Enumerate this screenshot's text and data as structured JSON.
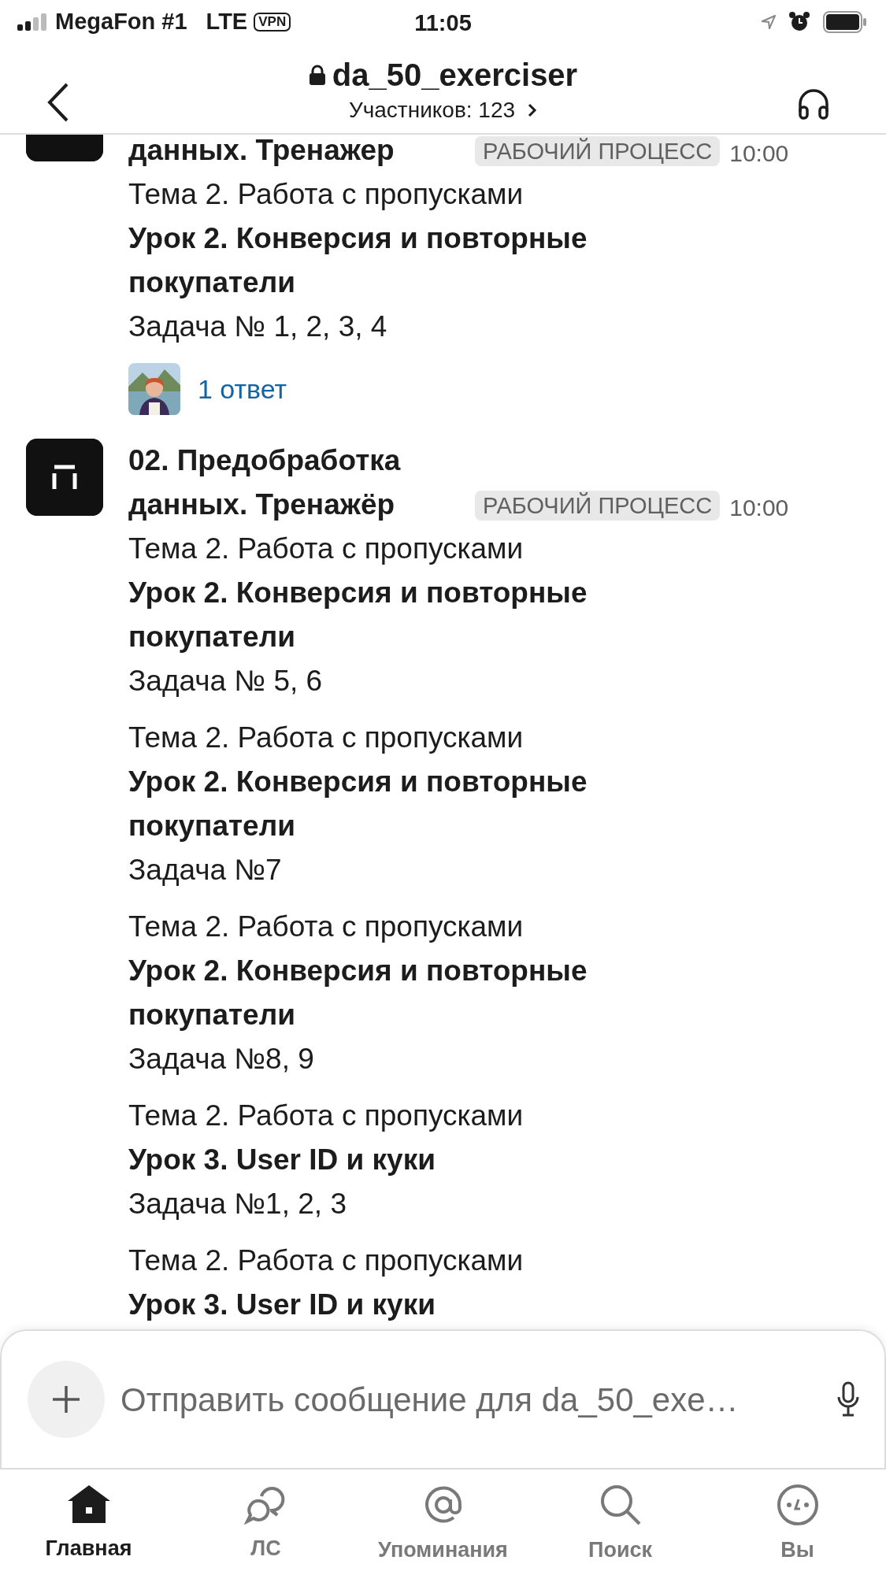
{
  "status_bar": {
    "carrier": "MegaFon #1",
    "network": "LTE",
    "vpn": "VPN",
    "time": "11:05"
  },
  "header": {
    "title": "da_50_exerciser",
    "members": "Участников: 123"
  },
  "messages": [
    {
      "name": "данных. Тренажер",
      "tag": "РАБОЧИЙ ПРОЦЕСС",
      "time": "10:00",
      "posts": [
        {
          "topic": "Тема 2. Работа с пропусками",
          "lesson": "Урок 2. Конверсия и повторные покупатели",
          "task": "Задача № 1, 2, 3, 4"
        }
      ],
      "replies": "1 ответ"
    },
    {
      "name": "02. Предобработка данных. Тренажёр",
      "tag": "РАБОЧИЙ ПРОЦЕСС",
      "time": "10:00",
      "posts": [
        {
          "topic": "Тема 2. Работа с пропусками",
          "lesson": "Урок 2. Конверсия и повторные покупатели",
          "task": "Задача № 5, 6"
        },
        {
          "topic": "Тема 2. Работа с пропусками",
          "lesson": "Урок 2. Конверсия и повторные покупатели",
          "task": "Задача №7"
        },
        {
          "topic": "Тема 2. Работа с пропусками",
          "lesson": "Урок 2. Конверсия и повторные покупатели",
          "task": "Задача №8, 9"
        },
        {
          "topic": "Тема 2. Работа с пропусками",
          "lesson": "Урок 3. User ID и куки",
          "task": "Задача №1, 2, 3"
        },
        {
          "topic": "Тема 2. Работа с пропусками",
          "lesson": "Урок 3. User ID и куки"
        }
      ]
    }
  ],
  "composer": {
    "placeholder": "Отправить сообщение для da_50_exe…"
  },
  "tabs": [
    {
      "label": "Главная",
      "selected": true
    },
    {
      "label": "ЛС",
      "selected": false
    },
    {
      "label": "Упоминания",
      "selected": false
    },
    {
      "label": "Поиск",
      "selected": false
    },
    {
      "label": "Вы",
      "selected": false
    }
  ]
}
